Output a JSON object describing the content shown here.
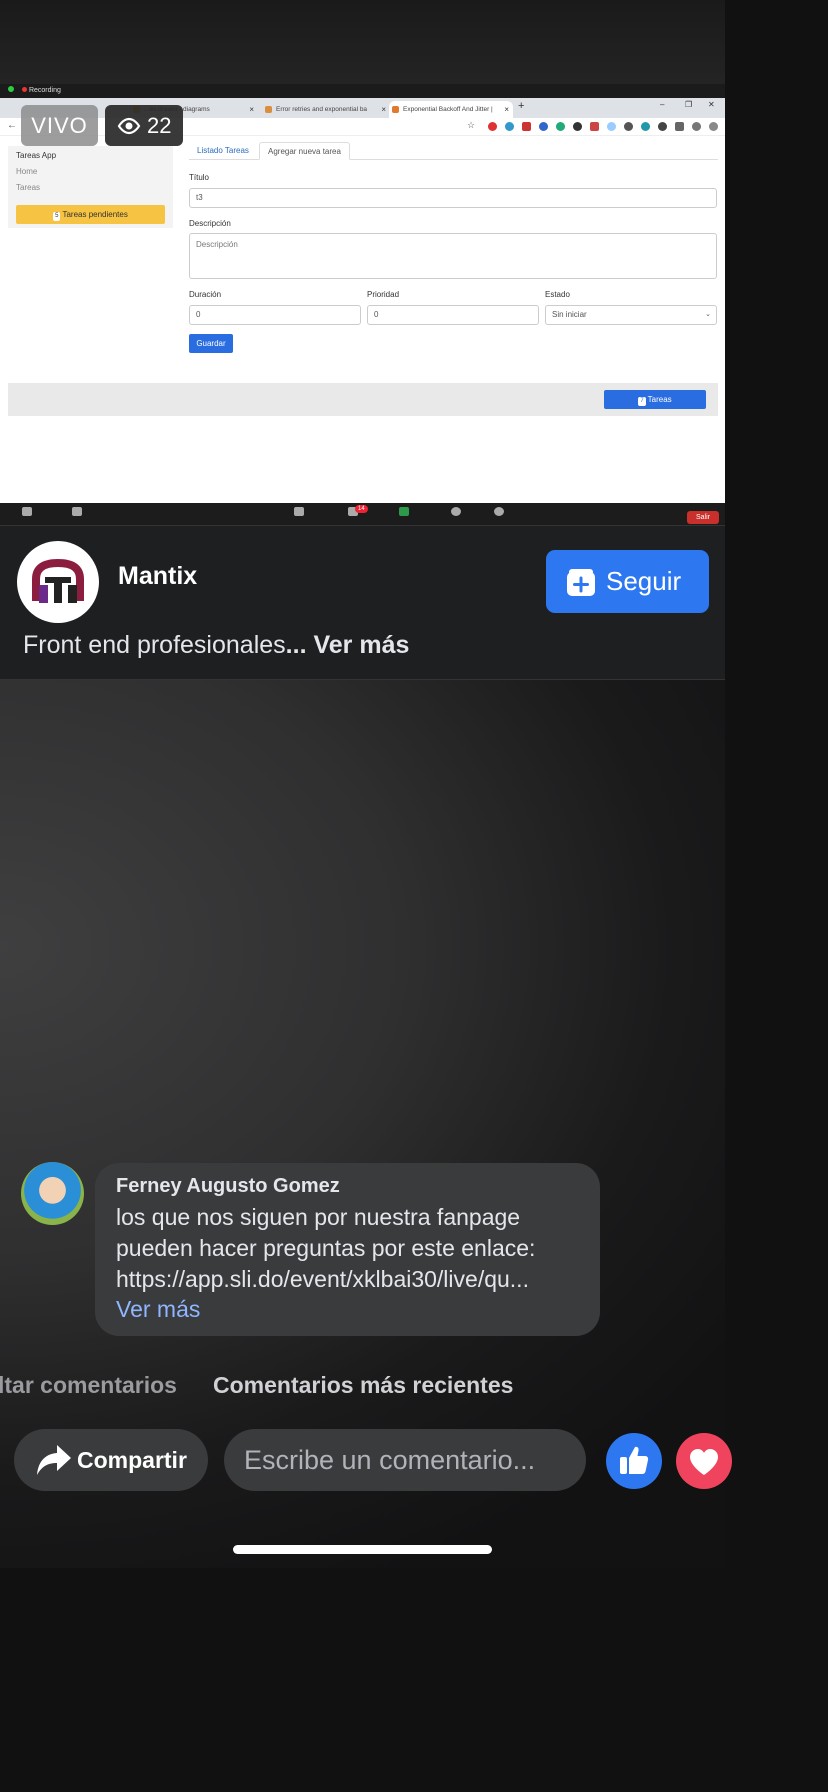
{
  "stream": {
    "live_label": "VIVO",
    "viewer_count": "22",
    "recording_label": "Recording"
  },
  "browser": {
    "tabs": [
      {
        "label": "...es.drawio - diagrams",
        "color": "#e8a33c"
      },
      {
        "label": "Error retries and exponential ba",
        "color": "#d98e3f"
      },
      {
        "label": "Exponential Backoff And Jitter | ",
        "color": "#e07a2e"
      }
    ]
  },
  "app": {
    "sidebar": {
      "title": "Tareas App",
      "items": [
        "Home",
        "Tareas"
      ],
      "pending_button": {
        "count": "5",
        "label": "Tareas pendientes"
      }
    },
    "tabs": [
      "Listado Tareas",
      "Agregar nueva tarea"
    ],
    "form": {
      "titulo_label": "Título",
      "titulo_value": "t3",
      "descripcion_label": "Descripción",
      "descripcion_placeholder": "Descripción",
      "duracion_label": "Duración",
      "duracion_value": "0",
      "prioridad_label": "Prioridad",
      "prioridad_value": "0",
      "estado_label": "Estado",
      "estado_value": "Sin iniciar",
      "save_label": "Guardar"
    },
    "footer_button": {
      "count": "7",
      "label": "Tareas"
    }
  },
  "zoom": {
    "chat_badge": "14",
    "participants": "100",
    "leave_label": "Salir"
  },
  "page": {
    "name": "Mantix",
    "follow_label": "Seguir",
    "description": "Front end profesionales",
    "ellipsis": "... ",
    "see_more": "Ver más"
  },
  "comment": {
    "author": "Ferney Augusto Gomez",
    "lines": [
      "los que nos siguen por nuestra fanpage",
      "pueden hacer preguntas por este enlace:",
      "https://app.sli.do/event/xklbai30/live/qu..."
    ],
    "see_more": "Ver más"
  },
  "sort": {
    "option_a": "ltar comentarios",
    "option_b": "Comentarios más recientes"
  },
  "actions": {
    "share_label": "Compartir",
    "comment_placeholder": "Escribe un comentario..."
  },
  "colors": {
    "accent_blue": "#2d78f0",
    "love_red": "#f0445e",
    "pending_yellow": "#f6c342"
  }
}
